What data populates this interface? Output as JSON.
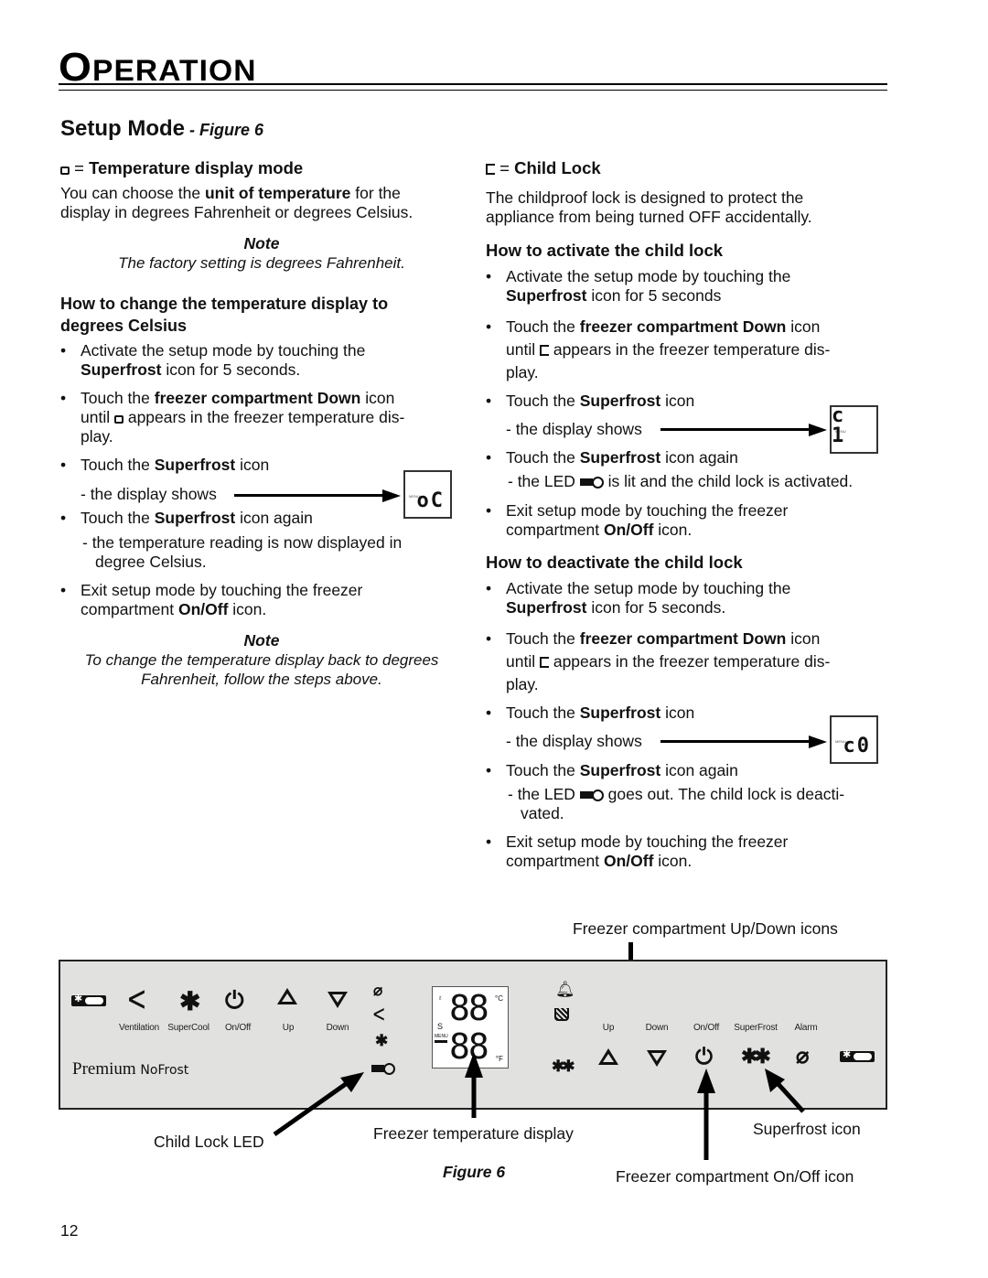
{
  "header": {
    "title_first": "O",
    "title_rest": "PERATION",
    "section_title": "Setup Mode",
    "section_ref": " - Figure 6"
  },
  "left": {
    "heading_eq": " = ",
    "heading": "Temperature display mode",
    "intro_1a": "You can choose the ",
    "intro_1b": "unit of temperature",
    "intro_1c": " for the",
    "intro_2": "display in degrees Fahrenheit or degrees Celsius.",
    "note1_title": "Note",
    "note1_text": "The factory setting is degrees Fahrenheit.",
    "subheading_1": "How to change the temperature display to",
    "subheading_2": "degrees Celsius",
    "steps": {
      "s1_l1": "Activate the setup mode by touching the",
      "s1_bold": "Superfrost",
      "s1_l2": " icon for 5 seconds.",
      "s2_a": "Touch the ",
      "s2_bold": "freezer compartment Down",
      "s2_b": " icon",
      "s2_l2a": "until ",
      "s2_l2b": " appears in the freezer temperature dis-",
      "s2_l3": "play.",
      "s3_a": "Touch the ",
      "s3_bold": "Superfrost",
      "s3_b": " icon",
      "s3_sub": "- the display shows",
      "s3_display": "oC",
      "s4_a": "Touch the ",
      "s4_bold": "Superfrost",
      "s4_b": " icon again",
      "s4_sub1": "- the temperature reading is now displayed in",
      "s4_sub2": "degree Celsius.",
      "s5_l1": "Exit setup mode by touching the freezer",
      "s5_a": "compartment ",
      "s5_bold": "On/Off",
      "s5_b": " icon."
    },
    "note2_title": "Note",
    "note2_text1": "To change the temperature display back to degrees",
    "note2_text2": "Fahrenheit, follow the steps above."
  },
  "right": {
    "heading_eq": " = ",
    "heading": "Child Lock",
    "intro_1": "The childproof lock is designed to protect the",
    "intro_2": "appliance from being turned OFF accidentally.",
    "activate_heading": "How to activate the child lock",
    "activate": {
      "s1_l1": "Activate the setup mode by touching the",
      "s1_bold": "Superfrost",
      "s1_l2": " icon for 5 seconds",
      "s2_a": "Touch the ",
      "s2_bold": "freezer compartment Down",
      "s2_b": " icon",
      "s2_l2a": "until ",
      "s2_l2b": " appears in the freezer temperature dis-",
      "s2_l3": "play.",
      "s3_a": "Touch the ",
      "s3_bold": "Superfrost",
      "s3_b": " icon",
      "s3_sub": "- the display shows",
      "s3_display": "c 1",
      "s4_a": "Touch the ",
      "s4_bold": "Superfrost",
      "s4_b": " icon again",
      "s4_sub_a": "- the LED ",
      "s4_sub_b": " is lit and the child lock is activated.",
      "s5_l1": "Exit setup mode by touching the freezer",
      "s5_a": "compartment ",
      "s5_bold": "On/Off",
      "s5_b": " icon."
    },
    "deactivate_heading": "How to deactivate the child lock",
    "deactivate": {
      "s1_l1": "Activate the setup mode by touching the",
      "s1_bold": "Superfrost",
      "s1_l2": " icon for 5 seconds.",
      "s2_a": "Touch the ",
      "s2_bold": "freezer compartment Down",
      "s2_b": " icon",
      "s2_l2a": "until ",
      "s2_l2b": " appears in the freezer temperature dis-",
      "s2_l3": "play.",
      "s3_a": "Touch the ",
      "s3_bold": "Superfrost",
      "s3_b": " icon",
      "s3_sub": "- the display shows",
      "s3_display": "c0",
      "s4_a": "Touch the ",
      "s4_bold": "Superfrost",
      "s4_b": " icon again",
      "s4_sub_a": "- the LED ",
      "s4_sub_b": " goes out. The child lock is deacti-",
      "s4_sub_c": "vated.",
      "s5_l1": "Exit setup mode by touching the freezer",
      "s5_a": "compartment ",
      "s5_bold": "On/Off",
      "s5_b": " icon."
    }
  },
  "figure": {
    "caption": "Figure 6",
    "menu_label": "MENU",
    "panel_left_labels": [
      "Ventilation",
      "SuperCool",
      "On/Off",
      "Up",
      "Down"
    ],
    "panel_right_labels": [
      "Up",
      "Down",
      "On/Off",
      "SuperFrost",
      "Alarm"
    ],
    "brand_1": "Premium",
    "brand_2": "NoFrost",
    "display_top": "88",
    "display_bottom": "88",
    "unit_c": "°C",
    "unit_f": "°F",
    "s_label": "S",
    "callouts": {
      "up_down": "Freezer compartment Up/Down icons",
      "child_lock_led": "Child Lock LED",
      "temp_display": "Freezer temperature display",
      "superfrost": "Superfrost icon",
      "on_off": "Freezer compartment On/Off icon"
    }
  },
  "footer": {
    "page_number": "12"
  }
}
